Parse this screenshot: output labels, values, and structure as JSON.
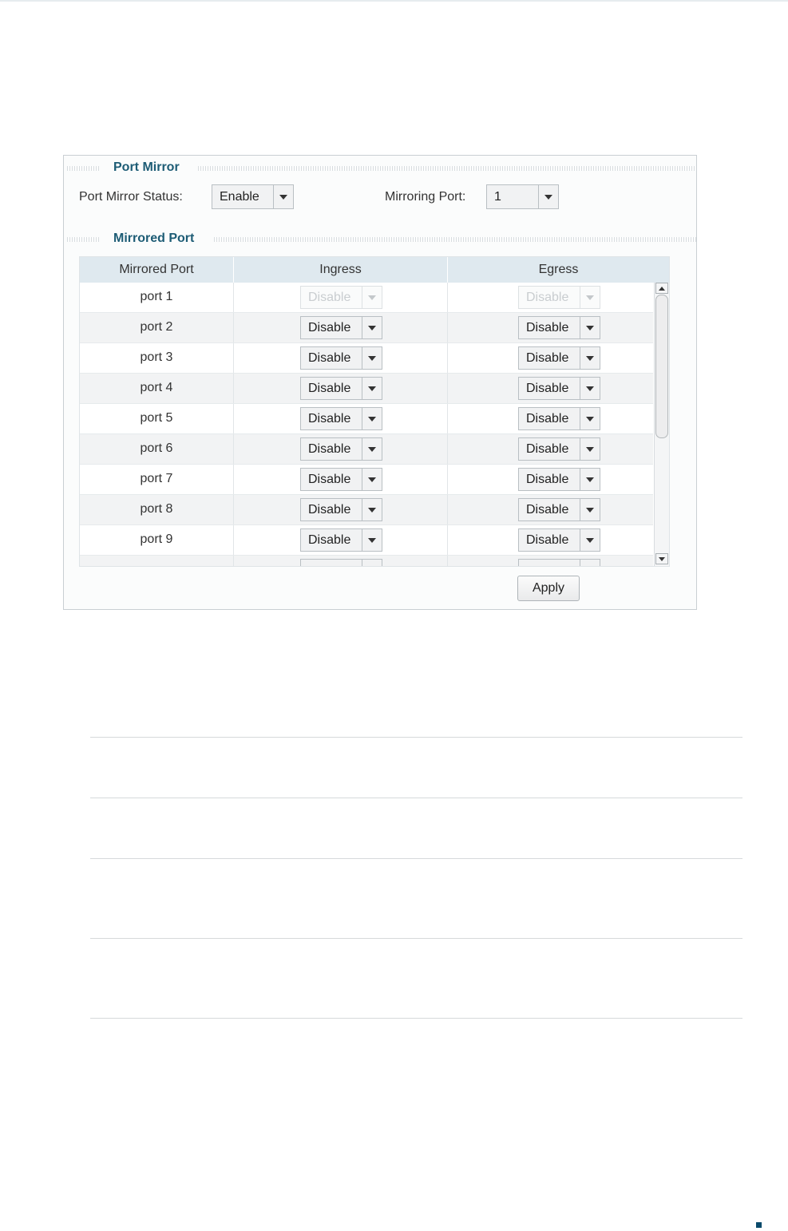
{
  "port_mirror": {
    "section_title": "Port Mirror",
    "status_label": "Port Mirror Status:",
    "status_value": "Enable",
    "mirroring_port_label": "Mirroring Port:",
    "mirroring_port_value": "1"
  },
  "mirrored_port": {
    "section_title": "Mirrored Port",
    "columns": [
      "Mirrored Port",
      "Ingress",
      "Egress"
    ],
    "rows": [
      {
        "port": "port 1",
        "ingress": "Disable",
        "egress": "Disable",
        "disabled": true
      },
      {
        "port": "port 2",
        "ingress": "Disable",
        "egress": "Disable",
        "disabled": false
      },
      {
        "port": "port 3",
        "ingress": "Disable",
        "egress": "Disable",
        "disabled": false
      },
      {
        "port": "port 4",
        "ingress": "Disable",
        "egress": "Disable",
        "disabled": false
      },
      {
        "port": "port 5",
        "ingress": "Disable",
        "egress": "Disable",
        "disabled": false
      },
      {
        "port": "port 6",
        "ingress": "Disable",
        "egress": "Disable",
        "disabled": false
      },
      {
        "port": "port 7",
        "ingress": "Disable",
        "egress": "Disable",
        "disabled": false
      },
      {
        "port": "port 8",
        "ingress": "Disable",
        "egress": "Disable",
        "disabled": false
      },
      {
        "port": "port 9",
        "ingress": "Disable",
        "egress": "Disable",
        "disabled": false
      },
      {
        "port": "",
        "ingress": "",
        "egress": "",
        "disabled": false
      }
    ]
  },
  "apply_label": "Apply",
  "colors": {
    "section_title": "#1d5c75",
    "header_bg": "#dfe9ef",
    "page_mark": "#0a4a6b"
  }
}
